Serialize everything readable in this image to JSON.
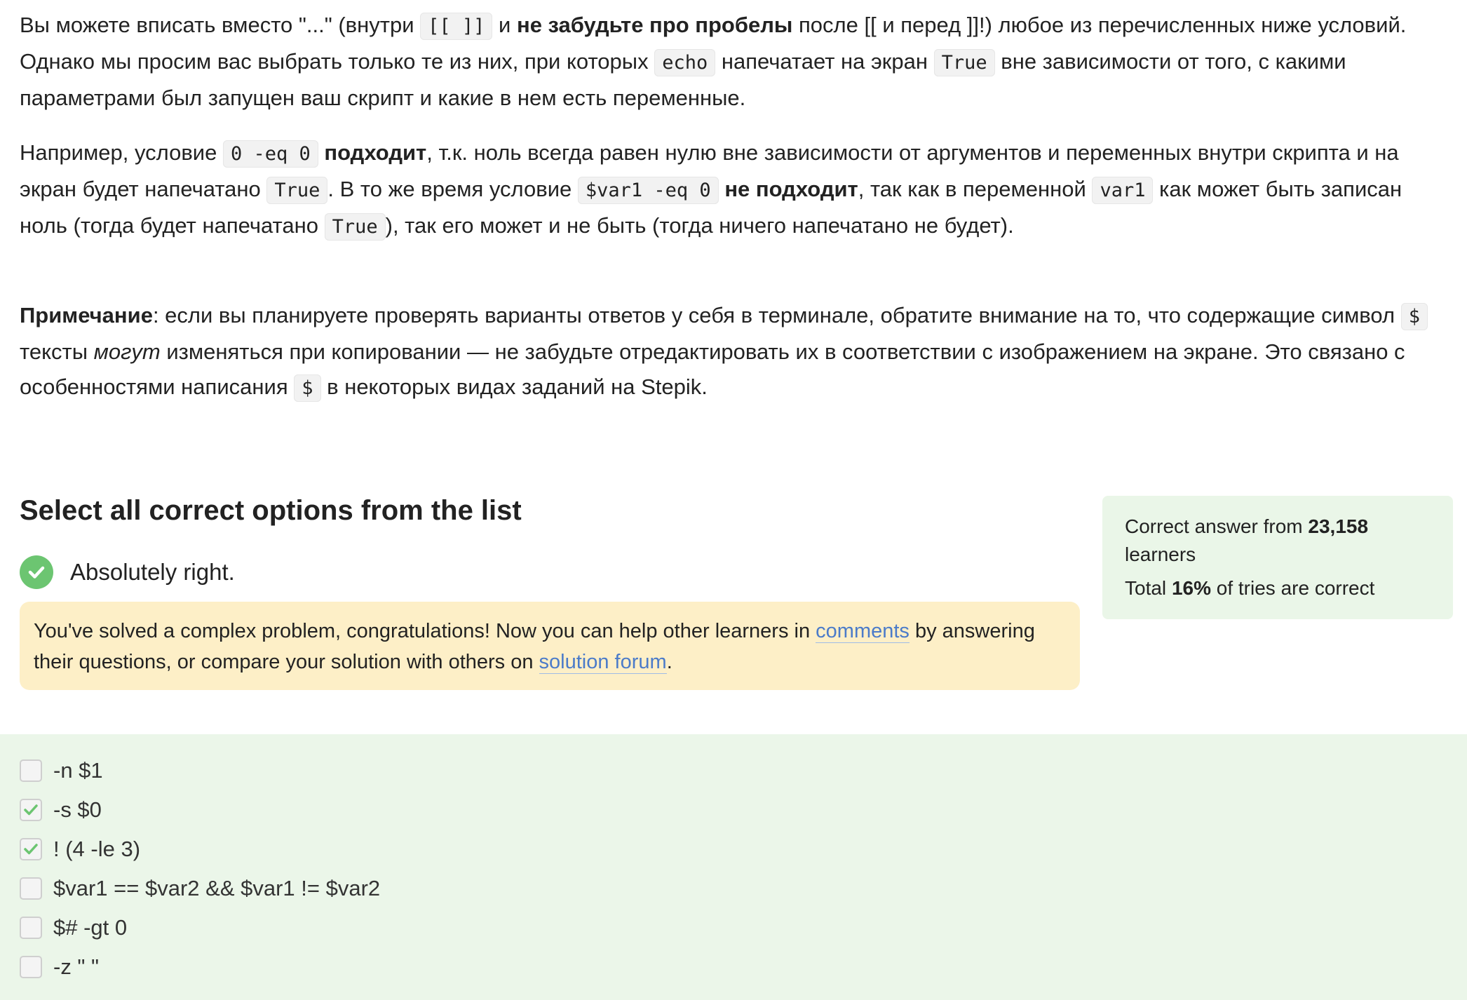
{
  "intro": {
    "p1": {
      "t1": "Вы можете вписать вместо \"...\" (внутри ",
      "c1": "[[ ]]",
      "t2": " и ",
      "b1": "не забудьте про пробелы",
      "t3": " после [[ и перед ]]!) любое из перечисленных ниже условий. Однако мы просим вас выбрать только те из них, при которых ",
      "c2": "echo",
      "t4": " напечатает на экран ",
      "c3": "True",
      "t5": " вне зависимости от того, с какими параметрами был запущен ваш скрипт и какие в нем есть переменные."
    },
    "p2": {
      "t1": "Например, условие ",
      "c1": "0 -eq 0",
      "t2": " ",
      "b1": "подходит",
      "t3": ", т.к. ноль всегда равен нулю вне зависимости от аргументов и переменных внутри скрипта и на экран будет напечатано ",
      "c2": "True",
      "t4": ". В то же время условие ",
      "c3": "$var1 -eq 0",
      "t5": " ",
      "b2": "не подходит",
      "t6": ", так как в переменной ",
      "c4": "var1",
      "t7": " как может быть записан ноль (тогда будет напечатано ",
      "c5": "True",
      "t8": "), так его может и не быть (тогда ничего напечатано не будет)."
    },
    "p3": {
      "b1": "Примечание",
      "t1": ": если вы планируете проверять варианты ответов у себя в терминале, обратите внимание на то, что содержащие символ ",
      "c1": "$",
      "t2": " тексты ",
      "i1": "могут",
      "t3": " изменяться при копировании — не забудьте отредактировать их в соответствии с изображением на экране. Это связано с особенностями написания ",
      "c2": "$",
      "t4": " в некоторых видах заданий на Stepik."
    }
  },
  "task": {
    "title": "Select all correct options from the list",
    "result_text": "Absolutely right.",
    "result_icon": "check-circle-icon",
    "success_color": "#6cc571"
  },
  "stats": {
    "line1_prefix": "Correct answer from ",
    "learners_count": "23,158",
    "line1_suffix": " learners",
    "line2_prefix": "Total ",
    "percent": "16%",
    "line2_suffix": " of tries are correct"
  },
  "hint": {
    "t1": "You've solved a complex problem, congratulations! Now you can help other learners in ",
    "link1": "comments",
    "t2": " by answering their questions, or compare your solution with others on ",
    "link2": "solution forum",
    "t3": "."
  },
  "options": [
    {
      "label": "-n $1",
      "checked": false
    },
    {
      "label": "-s $0",
      "checked": true
    },
    {
      "label": "! (4 -le 3)",
      "checked": true
    },
    {
      "label": "$var1 == $var2 && $var1 != $var2",
      "checked": false
    },
    {
      "label": "$# -gt 0",
      "checked": false
    },
    {
      "label": "-z \" \"",
      "checked": false
    }
  ]
}
